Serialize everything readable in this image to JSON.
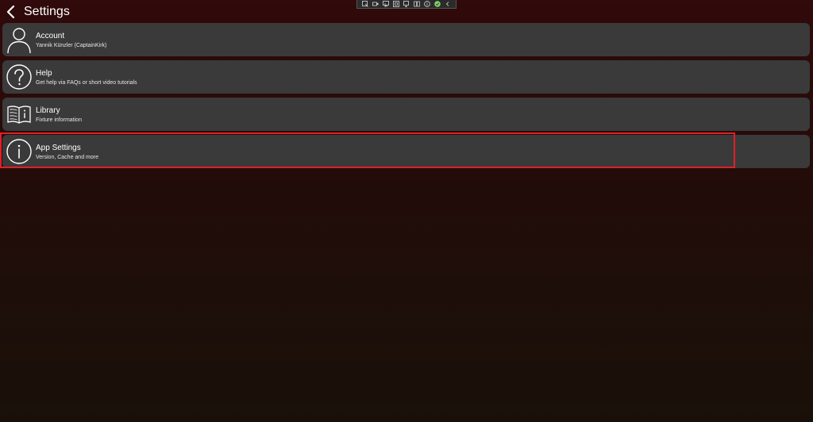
{
  "header": {
    "title": "Settings",
    "back_icon": "chevron-left-icon"
  },
  "dev_toolbar": {
    "icons": [
      "select-element-icon",
      "video-icon",
      "pointer-icon",
      "layout-icon",
      "inspect-icon",
      "binding-icon",
      "info-icon",
      "check-icon",
      "collapse-icon"
    ]
  },
  "settings_list": {
    "items": [
      {
        "label": "Account",
        "subtitle": "Yannik Künzler (CaptainKirk)",
        "icon": "user-icon"
      },
      {
        "label": "Help",
        "subtitle": "Get help via FAQs or short video tutorials",
        "icon": "question-circle-icon"
      },
      {
        "label": "Library",
        "subtitle": "Fixture information",
        "icon": "book-icon"
      },
      {
        "label": "App Settings",
        "subtitle": "Version, Cache and more",
        "icon": "info-circle-icon"
      }
    ]
  },
  "colors": {
    "item_background": "#3a3a3a",
    "highlight": "#e0202a",
    "text": "#ffffff"
  }
}
